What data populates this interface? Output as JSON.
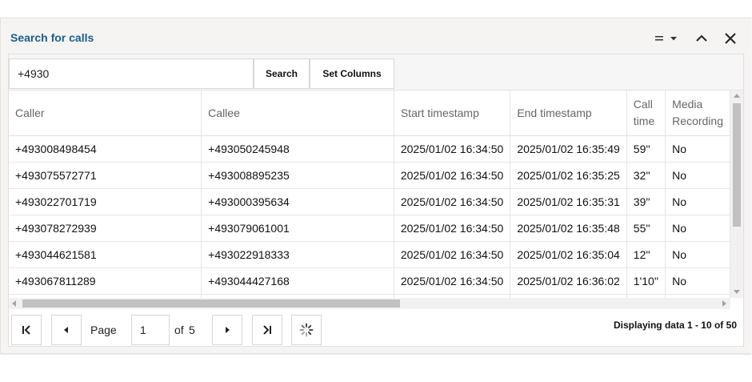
{
  "window": {
    "title": "Search for calls",
    "tools": [
      "menu-icon",
      "collapse-icon",
      "close-icon"
    ]
  },
  "toolbar": {
    "search_value": "+4930",
    "search_label": "Search",
    "set_columns_label": "Set Columns"
  },
  "grid": {
    "columns": [
      "Caller",
      "Callee",
      "Start timestamp",
      "End timestamp",
      "Call time",
      "Media Recording"
    ],
    "rows": [
      [
        "+493008498454",
        "+493050245948",
        "2025/01/02 16:34:50",
        "2025/01/02 16:35:49",
        "59''",
        "No"
      ],
      [
        "+493075572771",
        "+493008895235",
        "2025/01/02 16:34:50",
        "2025/01/02 16:35:25",
        "32''",
        "No"
      ],
      [
        "+493022701719",
        "+493000395634",
        "2025/01/02 16:34:50",
        "2025/01/02 16:35:31",
        "39''",
        "No"
      ],
      [
        "+493078272939",
        "+493079061001",
        "2025/01/02 16:34:50",
        "2025/01/02 16:35:48",
        "55''",
        "No"
      ],
      [
        "+493044621581",
        "+493022918333",
        "2025/01/02 16:34:50",
        "2025/01/02 16:35:04",
        "12''",
        "No"
      ],
      [
        "+493067811289",
        "+493044427168",
        "2025/01/02 16:34:50",
        "2025/01/02 16:36:02",
        "1'10''",
        "No"
      ]
    ]
  },
  "pager": {
    "page_label": "Page",
    "page_value": "1",
    "of_label": "of",
    "total_pages": "5",
    "display_info": "Displaying data 1 - 10 of 50"
  },
  "colors": {
    "title": "#1a5e8e",
    "panel_bg": "#f5f4f2",
    "border": "#d7d7d7"
  }
}
